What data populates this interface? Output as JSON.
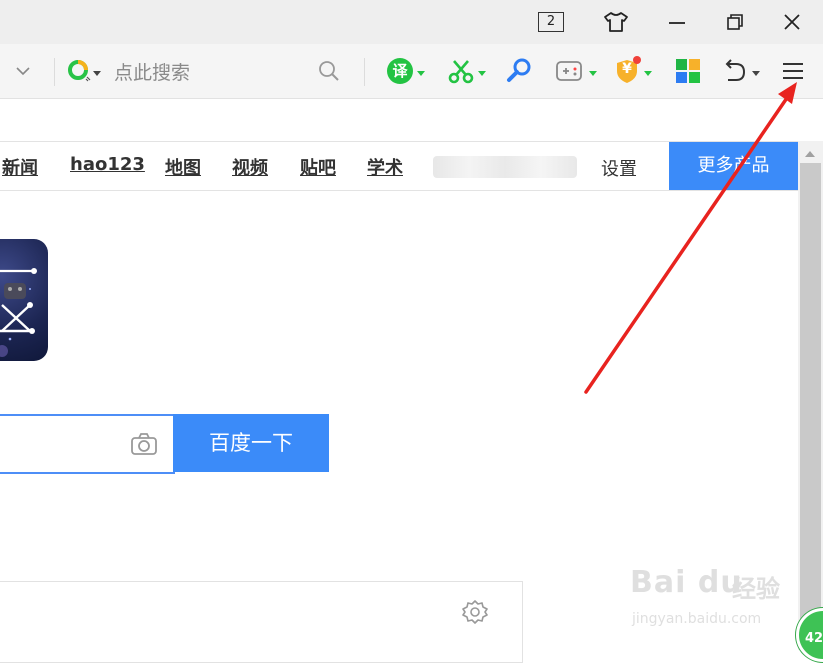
{
  "window": {
    "tab_count": "2",
    "icons": [
      "skin-shirt-icon",
      "minimize-icon",
      "restore-icon",
      "close-icon"
    ]
  },
  "toolbar": {
    "search_placeholder": "点此搜索",
    "translate_label": "译",
    "coupon_label": "¥",
    "icons": [
      "address-dropdown-chevron-icon",
      "search-engine-logo-icon",
      "magnifier-icon",
      "translate-icon",
      "screenshot-scissors-icon",
      "zoom-search-icon",
      "game-controller-icon",
      "coupon-shield-icon",
      "app-grid-icon",
      "undo-icon",
      "main-menu-icon"
    ],
    "accent_green": "#23c343",
    "accent_blue": "#2d7cf2"
  },
  "nav": {
    "links": [
      "新闻",
      "hao123",
      "地图",
      "视频",
      "贴吧",
      "学术"
    ],
    "settings": "设置",
    "more_products": "更多产品"
  },
  "search": {
    "button": "百度一下",
    "icons": [
      "camera-icon"
    ]
  },
  "panel": {
    "icons": [
      "gear-icon"
    ]
  },
  "watermark": {
    "logo_text": "Bai du",
    "logo_cn": "经验",
    "url": "jingyan.baidu.com"
  },
  "badge": {
    "value": "42"
  },
  "annotation": {
    "color": "#e8231f"
  }
}
